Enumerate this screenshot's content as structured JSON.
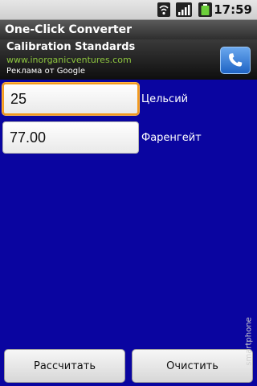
{
  "status_bar": {
    "time": "17:59",
    "icons": [
      "wifi-icon",
      "signal-icon",
      "battery-icon"
    ]
  },
  "app": {
    "title": "One-Click Converter"
  },
  "ad": {
    "title": "Calibration Standards",
    "url": "www.inorganicventures.com",
    "label": "Реклама от Google",
    "call_icon": "phone-icon"
  },
  "converter": {
    "celsius": {
      "value": "25",
      "unit_label": "Цельсий"
    },
    "fahrenheit": {
      "value": "77.00",
      "unit_label": "Фаренгейт"
    }
  },
  "buttons": {
    "calculate": "Рассчитать",
    "clear": "Очистить"
  },
  "watermark": "smartphone",
  "colors": {
    "background": "#0a05a0",
    "focus_border": "#f39a1d",
    "ad_url": "#8ec63f"
  }
}
